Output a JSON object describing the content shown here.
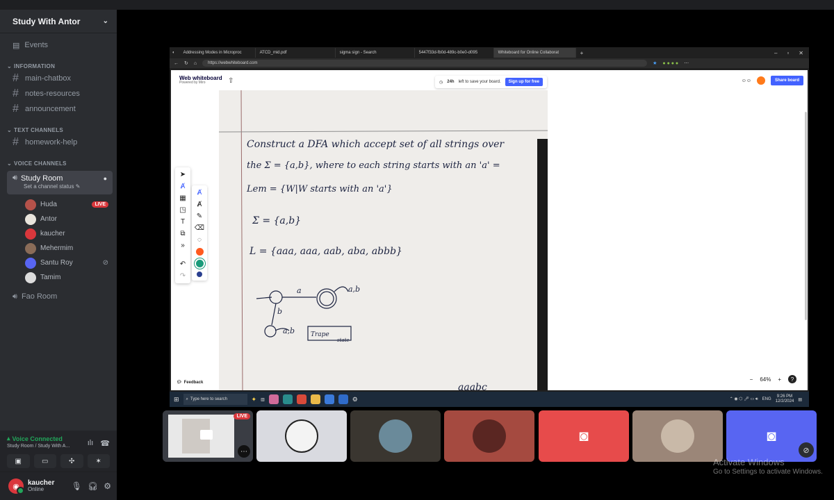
{
  "server": {
    "name": "Study With Antor"
  },
  "sidebar": {
    "events_label": "Events",
    "categories": {
      "information": "INFORMATION",
      "text": "TEXT CHANNELS",
      "voice": "VOICE CHANNELS"
    },
    "info_channels": [
      "main-chatbox",
      "notes-resources",
      "announcement"
    ],
    "text_channels": [
      "homework-help"
    ],
    "voice_channel": {
      "name": "Study Room",
      "status": "Set a channel status"
    },
    "members": [
      {
        "name": "Huda",
        "badge": "LIVE",
        "color": "#b5524a"
      },
      {
        "name": "Antor",
        "badge": "",
        "color": "#f0f0f0"
      },
      {
        "name": "kaucher",
        "badge": "",
        "color": "#da373c"
      },
      {
        "name": "Mehermim",
        "badge": "",
        "color": "#8a6c58"
      },
      {
        "name": "Santu Roy",
        "badge": "",
        "color": "#5865f2",
        "muted": true
      },
      {
        "name": "Tamim",
        "badge": "",
        "color": "#dcdcdc"
      }
    ],
    "other_voice": "Fao Room"
  },
  "voice_connection": {
    "title": "Voice Connected",
    "subtitle": "Study Room / Study With A..."
  },
  "user": {
    "name": "kaucher",
    "status": "Online"
  },
  "stream": {
    "tabs": [
      "Addressing Modes in Microproc",
      "ATCD_mid.pdf",
      "sigma sign - Search",
      "5447f33d-fb0d-489c-b0e0-d095",
      "Whiteboard for Online Collaborat"
    ],
    "url": "https://webwhiteboard.com",
    "whiteboard": {
      "logo": "Web whiteboard",
      "powered": "Powered by Miro",
      "save_time": "24h",
      "save_text": "left to save your board.",
      "signup": "Sign up for free",
      "share": "Share board",
      "feedback": "Feedback",
      "zoom": "64%"
    },
    "handwriting": {
      "line1": "Construct a DFA which accept set of all strings over",
      "line2": "the Σ = {a,b}, where to each string starts with an 'a' =",
      "line3": "Lem = {W|W starts with an 'a'}",
      "line4": "Σ = {a,b}",
      "line5": "L = {aaa, aaa, aab, aba, abbb}",
      "state_a": "a",
      "state_b": "b",
      "loop_label": "a,b",
      "dead_label": "a,b",
      "trap1": "Trape",
      "trap2": "state",
      "footer": "aaabc"
    },
    "taskbar": {
      "search": "Type here to search",
      "lang": "ENG",
      "time": "9:26 PM",
      "date": "12/2/2024"
    }
  },
  "tiles": [
    {
      "type": "stream",
      "badge": "LIVE"
    },
    {
      "type": "avatar",
      "color": "#d9dae0"
    },
    {
      "type": "avatar",
      "color": "#3a3630"
    },
    {
      "type": "avatar",
      "color": "#a54a40"
    },
    {
      "type": "discord",
      "color": "#e74b4b"
    },
    {
      "type": "avatar",
      "color": "#9b8678"
    },
    {
      "type": "discord",
      "color": "#5865f2",
      "muted": true
    }
  ],
  "watermark": {
    "line1": "Activate Windows",
    "line2": "Go to Settings to activate Windows."
  },
  "colors": {
    "sidebar": "#2b2d31",
    "accent": "#5865f2",
    "live": "#da373c",
    "connected": "#23a55a"
  }
}
